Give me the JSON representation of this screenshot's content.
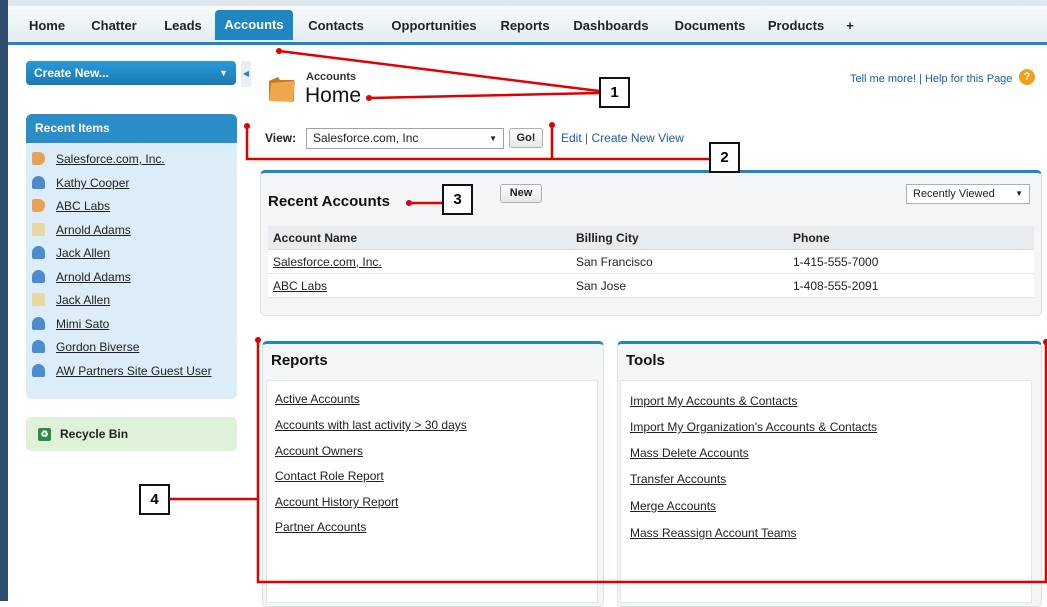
{
  "tabs": [
    {
      "label": "Home",
      "active": false
    },
    {
      "label": "Chatter",
      "active": false
    },
    {
      "label": "Leads",
      "active": false
    },
    {
      "label": "Accounts",
      "active": true
    },
    {
      "label": "Contacts",
      "active": false
    },
    {
      "label": "Opportunities",
      "active": false
    },
    {
      "label": "Reports",
      "active": false
    },
    {
      "label": "Dashboards",
      "active": false
    },
    {
      "label": "Documents",
      "active": false
    },
    {
      "label": "Products",
      "active": false
    },
    {
      "label": "+",
      "active": false
    }
  ],
  "sidebar": {
    "create_new_label": "Create New...",
    "recent_items_title": "Recent Items",
    "recent_items": [
      {
        "label": "Salesforce.com, Inc.",
        "icon": "account-icon"
      },
      {
        "label": "Kathy Cooper",
        "icon": "contact-icon"
      },
      {
        "label": "ABC Labs",
        "icon": "account-icon"
      },
      {
        "label": "Arnold Adams",
        "icon": "lead-icon"
      },
      {
        "label": "Jack Allen",
        "icon": "contact-icon"
      },
      {
        "label": "Arnold Adams",
        "icon": "contact-icon"
      },
      {
        "label": "Jack Allen",
        "icon": "lead-icon"
      },
      {
        "label": "Mimi Sato",
        "icon": "contact-icon"
      },
      {
        "label": "Gordon Biverse",
        "icon": "contact-icon"
      },
      {
        "label": "AW Partners Site Guest User",
        "icon": "contact-icon"
      }
    ],
    "recycle_bin_label": "Recycle Bin"
  },
  "header": {
    "object_label": "Accounts",
    "title": "Home",
    "help_text": "Tell me more! | Help for this Page"
  },
  "view": {
    "label": "View:",
    "selected": "Salesforce.com, Inc",
    "go_label": "Go!",
    "edit_label": "Edit",
    "separator": " | ",
    "create_view_label": "Create New View"
  },
  "recent_accounts": {
    "title": "Recent Accounts",
    "new_label": "New",
    "filter_selected": "Recently Viewed",
    "columns": [
      "Account Name",
      "Billing City",
      "Phone"
    ],
    "rows": [
      {
        "name": "Salesforce.com, Inc.",
        "city": "San Francisco",
        "phone": "1-415-555-7000"
      },
      {
        "name": "ABC Labs",
        "city": "San Jose",
        "phone": "1-408-555-2091"
      }
    ]
  },
  "reports": {
    "title": "Reports",
    "links": [
      "Active Accounts",
      "Accounts with last activity > 30 days",
      "Account Owners",
      "Contact Role Report",
      "Account History Report",
      "Partner Accounts"
    ]
  },
  "tools": {
    "title": "Tools",
    "links": [
      "Import My Accounts & Contacts",
      "Import My Organization's Accounts & Contacts",
      "Mass Delete Accounts",
      "Transfer Accounts",
      "Merge Accounts",
      "Mass Reassign Account Teams"
    ]
  },
  "callouts": [
    "1",
    "2",
    "3",
    "4"
  ],
  "colors": {
    "accent_blue": "#1f86c2",
    "annotation_red": "#e00000",
    "recent_items_bg": "#dcedf7",
    "recycle_bg": "#dff1d8"
  }
}
